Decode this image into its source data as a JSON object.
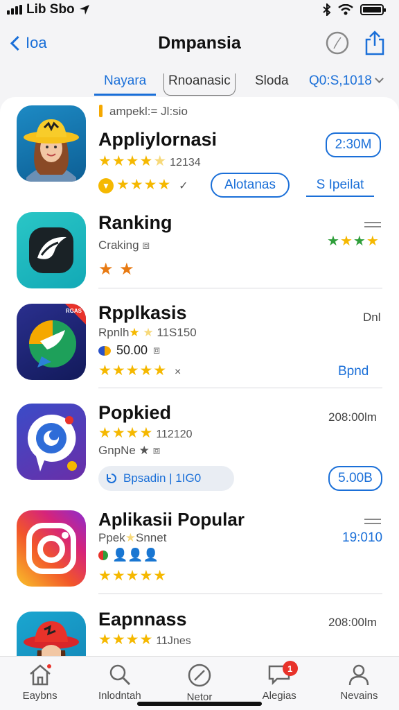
{
  "status_bar": {
    "carrier": "Lib Sbo"
  },
  "nav": {
    "back_label": "Ioa",
    "title": "Dmpansia"
  },
  "segments": [
    {
      "label": "Nayara"
    },
    {
      "label": "Rnoanasic"
    },
    {
      "label": "Sloda"
    },
    {
      "label": "Q0:S,1018"
    }
  ],
  "featured": {
    "tag": "ampekl:= Jl:sio",
    "name": "Appliylornasi",
    "rating_meta": "12134",
    "time_button": "2:30M",
    "action_primary": "Alotanas",
    "action_secondary": "S Ipeilat"
  },
  "ranking": {
    "name": "Ranking",
    "sub": "Craking"
  },
  "rpplkasis": {
    "name": "Rpplkasis",
    "sub": "Rpnlh",
    "sub_meta": "11S150",
    "price": "50.00",
    "corner_label": "Dnl",
    "icon_badge": "RGAS",
    "action": "Bpnd"
  },
  "popkied": {
    "name": "Popkied",
    "rating_meta": "112120",
    "sub": "GnpNe",
    "time": "208:00lm",
    "chip_label": "Bpsadin | 1IG0",
    "pill": "5.00B"
  },
  "popular": {
    "name": "Aplikasii Popular",
    "sub": "Ppek",
    "sub_meta": "Snnet",
    "link": "19:010"
  },
  "eapnass": {
    "name": "Eapnnass",
    "rating_meta": "11Jnes",
    "time": "208:00lm"
  },
  "tab_bar": {
    "items": [
      {
        "label": "Eaybns"
      },
      {
        "label": "Inlodntah"
      },
      {
        "label": "Netor"
      },
      {
        "label": "Alegias",
        "badge": "1"
      },
      {
        "label": "Nevains"
      }
    ]
  },
  "colors": {
    "accent": "#1a6fd8",
    "star": "#f5b800",
    "badge": "#e8322a"
  }
}
